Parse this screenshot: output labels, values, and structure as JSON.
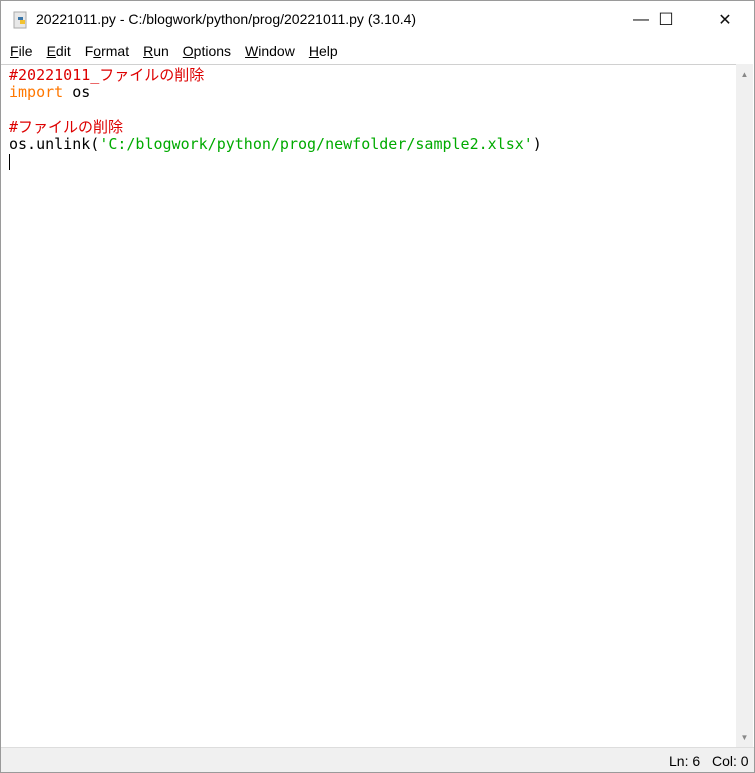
{
  "window": {
    "title": "20221011.py - C:/blogwork/python/prog/20221011.py (3.10.4)",
    "minimize": "—",
    "maximize": "☐",
    "close": "✕"
  },
  "menu": [
    {
      "first": "F",
      "rest": "ile"
    },
    {
      "first": "E",
      "rest": "dit"
    },
    {
      "pre": "F",
      "first": "o",
      "rest": "rmat"
    },
    {
      "first": "R",
      "rest": "un"
    },
    {
      "first": "O",
      "rest": "ptions"
    },
    {
      "first": "W",
      "rest": "indow"
    },
    {
      "first": "H",
      "rest": "elp"
    }
  ],
  "code": {
    "line1": "#20221011_ファイルの削除",
    "line2_kw": "import",
    "line2_rest": " os",
    "line4": "#ファイルの削除",
    "line5_pre": "os.unlink(",
    "line5_str": "'C:/blogwork/python/prog/newfolder/sample2.xlsx'",
    "line5_post": ")"
  },
  "status": {
    "ln": "Ln: 6",
    "col": "Col: 0"
  }
}
